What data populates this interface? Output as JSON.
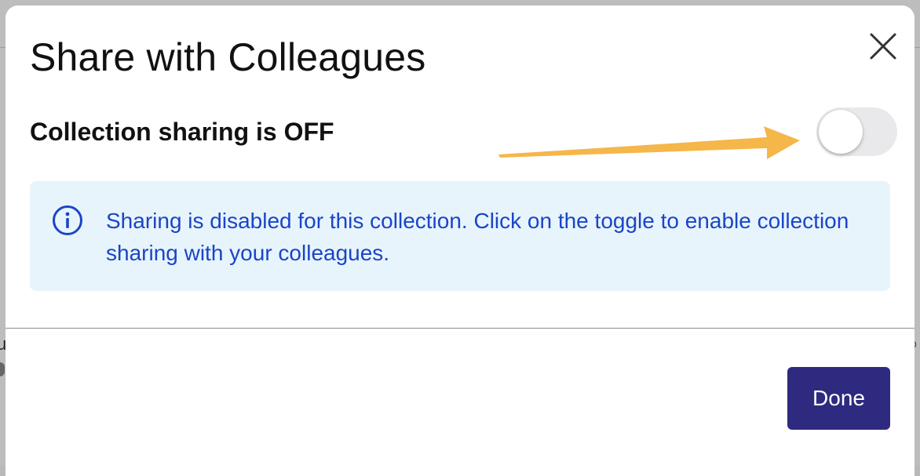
{
  "background": {
    "left_glyph": "u",
    "right_glyph": "o"
  },
  "dialog": {
    "title": "Share with Colleagues",
    "close_icon": "close-icon",
    "sharing": {
      "label": "Collection sharing is OFF",
      "toggle_state": "off"
    },
    "info": {
      "icon": "info-icon",
      "message": "Sharing is disabled for this collection. Click on the toggle to enable collection sharing with your colleagues."
    },
    "footer": {
      "done_label": "Done"
    }
  },
  "colors": {
    "accent_button": "#2e2a80",
    "info_background": "#e8f4fc",
    "info_text": "#1a45c8",
    "annotation_arrow": "#f5b64a",
    "toggle_off_track": "#e9e9eb"
  }
}
